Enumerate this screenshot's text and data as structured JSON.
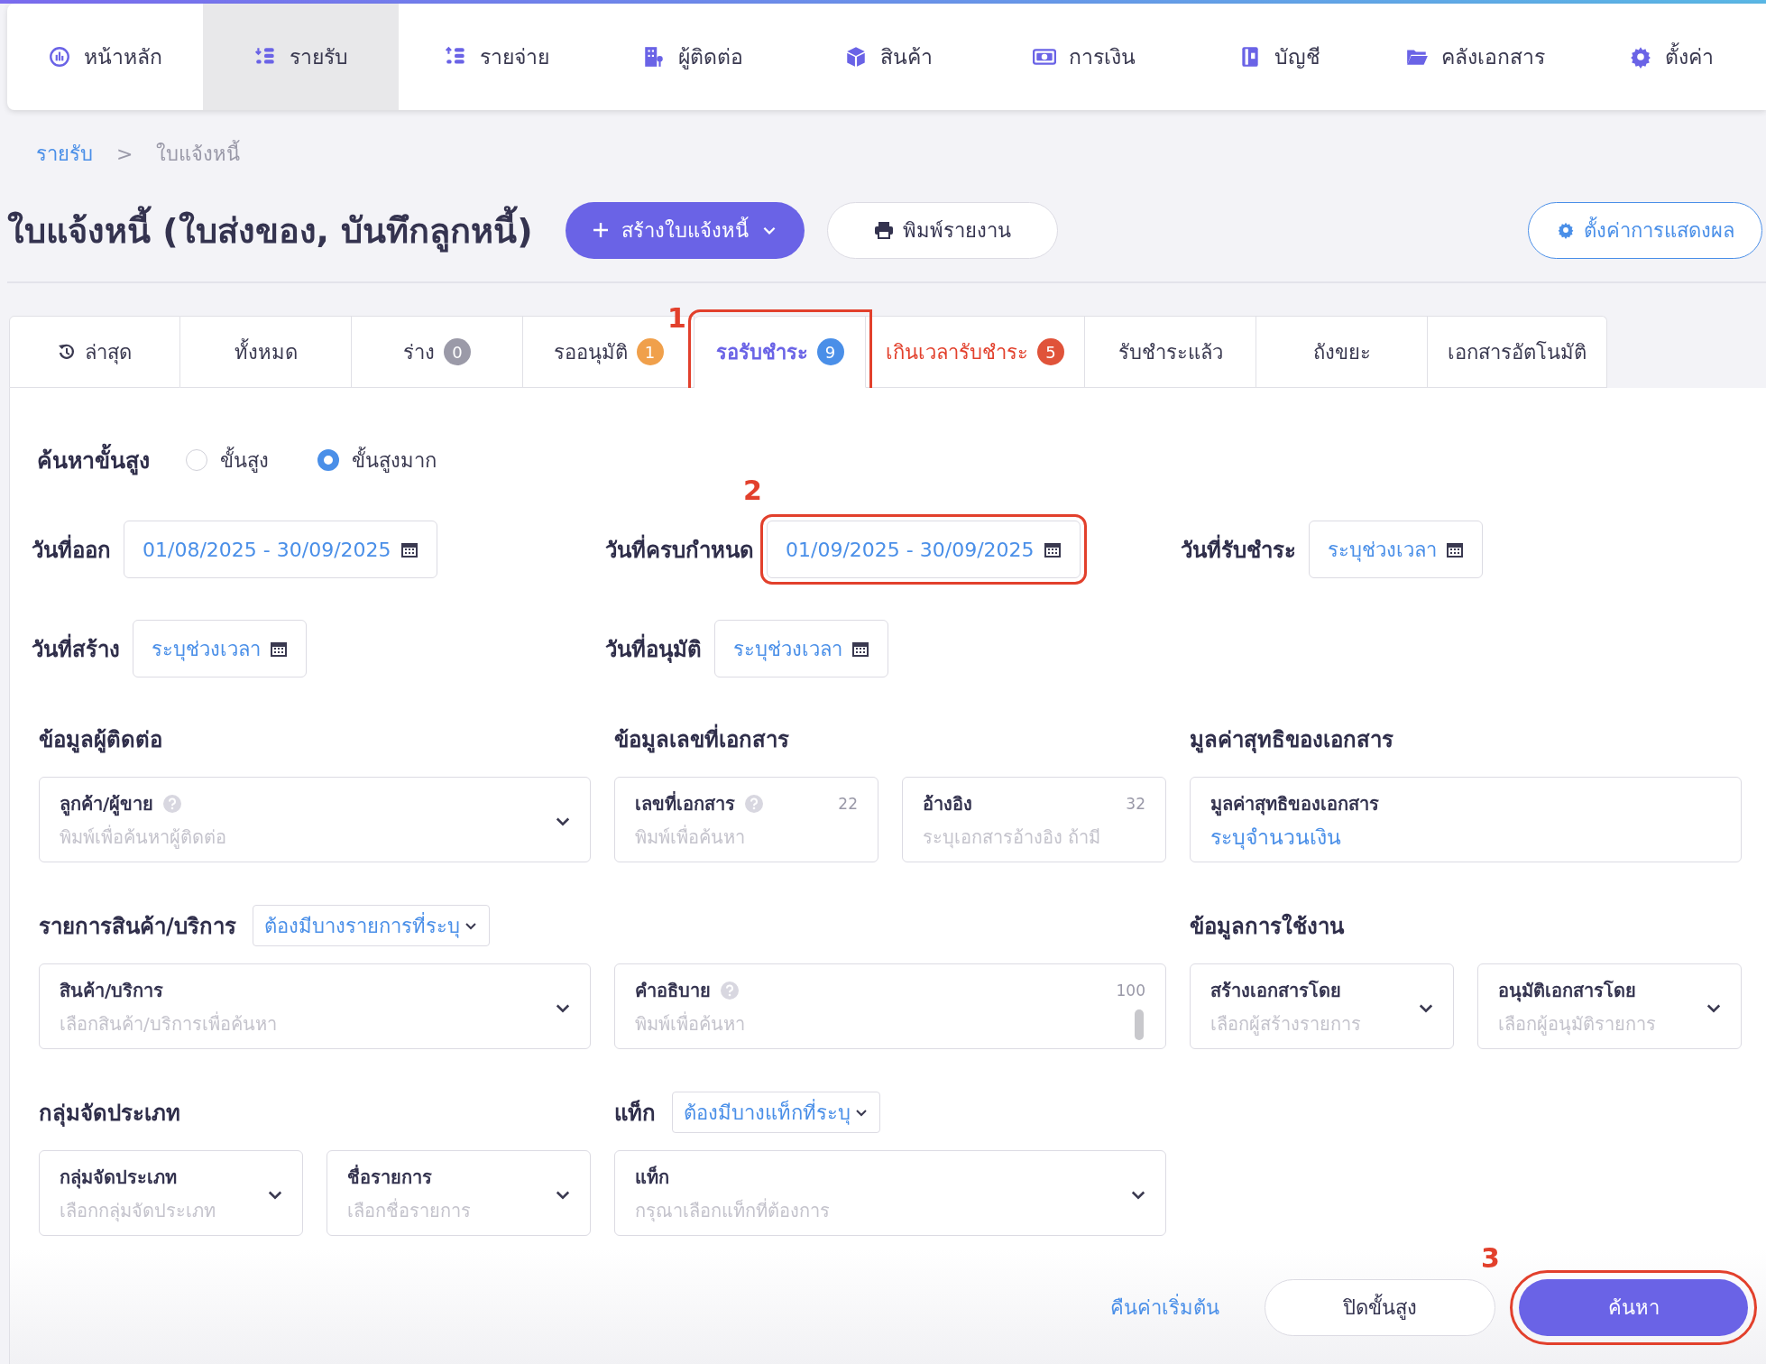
{
  "nav": [
    {
      "label": "หน้าหลัก",
      "selected": false
    },
    {
      "label": "รายรับ",
      "selected": true
    },
    {
      "label": "รายจ่าย",
      "selected": false
    },
    {
      "label": "ผู้ติดต่อ",
      "selected": false
    },
    {
      "label": "สินค้า",
      "selected": false
    },
    {
      "label": "การเงิน",
      "selected": false
    },
    {
      "label": "บัญชี",
      "selected": false
    },
    {
      "label": "คลังเอกสาร",
      "selected": false
    },
    {
      "label": "ตั้งค่า",
      "selected": false
    }
  ],
  "breadcrumb": {
    "link": "รายรับ",
    "separator": ">",
    "current": "ใบแจ้งหนี้"
  },
  "page_title": "ใบแจ้งหนี้ (ใบส่งของ, บันทึกลูกหนี้)",
  "create_button": "สร้างใบแจ้งหนี้",
  "print_button": "พิมพ์รายงาน",
  "display_settings_button": "ตั้งค่าการแสดงผล",
  "tabs": [
    {
      "label": "ล่าสุด",
      "selected": false,
      "alert": false
    },
    {
      "label": "ทั้งหมด",
      "selected": false,
      "alert": false
    },
    {
      "label": "ร่าง",
      "count": "0",
      "color": "#9b9aa8",
      "selected": false,
      "alert": false
    },
    {
      "label": "รออนุมัติ",
      "count": "1",
      "color": "#f0a04b",
      "selected": false,
      "alert": false
    },
    {
      "label": "รอรับชำระ",
      "count": "9",
      "color": "#4a8fe8",
      "selected": true,
      "alert": false,
      "annotation": "1"
    },
    {
      "label": "เกินเวลารับชำระ",
      "count": "5",
      "color": "#e0533a",
      "selected": false,
      "alert": true
    },
    {
      "label": "รับชำระแล้ว",
      "selected": false,
      "alert": false
    },
    {
      "label": "ถังขยะ",
      "selected": false,
      "alert": false
    },
    {
      "label": "เอกสารอัตโนมัติ",
      "selected": false,
      "alert": false
    }
  ],
  "advanced_search": {
    "label": "ค้นหาขั้นสูง",
    "options": [
      {
        "label": "ขั้นสูง",
        "selected": false
      },
      {
        "label": "ขั้นสูงมาก",
        "selected": true
      }
    ]
  },
  "date_filters": [
    [
      {
        "label": "วันที่ออก",
        "value": "01/08/2025 - 30/09/2025"
      },
      {
        "label": "วันที่ครบกำหนด",
        "value": "01/09/2025 - 30/09/2025",
        "annotation": "2"
      },
      {
        "label": "วันที่รับชำระ",
        "value": "ระบุช่วงเวลา"
      }
    ],
    [
      {
        "label": "วันที่สร้าง",
        "value": "ระบุช่วงเวลา"
      },
      {
        "label": "วันที่อนุมัติ",
        "value": "ระบุช่วงเวลา"
      }
    ]
  ],
  "filter_rows": [
    [
      {
        "heading": "ข้อมูลผู้ติดต่อ",
        "fields": [
          {
            "kind": "select",
            "label": "ลูกค้า/ผู้ขาย",
            "help": true,
            "placeholder": "พิมพ์เพื่อค้นหาผู้ติดต่อ"
          }
        ]
      },
      {
        "heading": "ข้อมูลเลขที่เอกสาร",
        "fields": [
          {
            "kind": "input",
            "label": "เลขที่เอกสาร",
            "help": true,
            "counter": "22",
            "placeholder": "พิมพ์เพื่อค้นหา"
          },
          {
            "kind": "input",
            "label": "อ้างอิง",
            "help": false,
            "counter": "32",
            "placeholder": "ระบุเอกสารอ้างอิง ถ้ามี"
          }
        ]
      },
      {
        "heading": "มูลค่าสุทธิของเอกสาร",
        "fields": [
          {
            "kind": "amount",
            "label": "มูลค่าสุทธิของเอกสาร",
            "help": false,
            "value": "ระบุจำนวนเงิน"
          }
        ]
      }
    ],
    [
      {
        "heading": "รายการสินค้า/บริการ",
        "mode": "ต้องมีบางรายการที่ระบุ",
        "fields": [
          {
            "kind": "select",
            "label": "สินค้า/บริการ",
            "help": false,
            "placeholder": "เลือกสินค้า/บริการเพื่อค้นหา"
          }
        ]
      },
      {
        "fields": [
          {
            "kind": "textarea",
            "label": "คำอธิบาย",
            "help": true,
            "counter": "100",
            "placeholder": "พิมพ์เพื่อค้นหา"
          }
        ]
      },
      {
        "heading": "ข้อมูลการใช้งาน",
        "fields": [
          {
            "kind": "select",
            "label": "สร้างเอกสารโดย",
            "help": false,
            "placeholder": "เลือกผู้สร้างรายการ"
          },
          {
            "kind": "select",
            "label": "อนุมัติเอกสารโดย",
            "help": false,
            "placeholder": "เลือกผู้อนุมัติรายการ"
          }
        ]
      }
    ],
    [
      {
        "heading": "กลุ่มจัดประเภท",
        "fields": [
          {
            "kind": "select",
            "label": "กลุ่มจัดประเภท",
            "help": false,
            "placeholder": "เลือกกลุ่มจัดประเภท"
          },
          {
            "kind": "select",
            "label": "ชื่อรายการ",
            "help": false,
            "placeholder": "เลือกชื่อรายการ"
          }
        ]
      },
      {
        "heading": "แท็ก",
        "mode": "ต้องมีบางแท็กที่ระบุ",
        "fields": [
          {
            "kind": "select",
            "label": "แท็ก",
            "help": false,
            "placeholder": "กรุณาเลือกแท็กที่ต้องการ"
          }
        ]
      }
    ]
  ],
  "reset_link": "คืนค่าเริ่มต้น",
  "close_button": "ปิดขั้นสูง",
  "search_button": {
    "label": "ค้นหา",
    "annotation": "3"
  }
}
